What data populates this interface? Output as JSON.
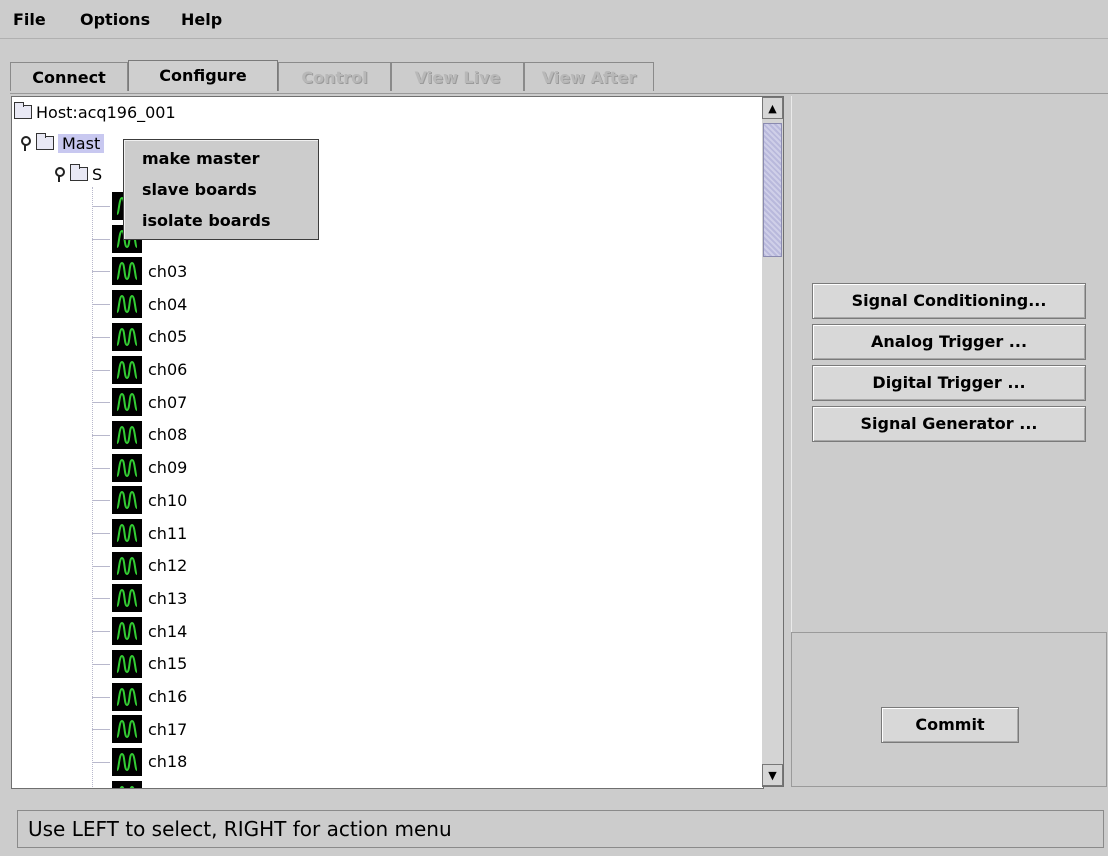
{
  "menu": {
    "file": "File",
    "options": "Options",
    "help": "Help"
  },
  "tabs": [
    {
      "label": "Connect",
      "state": "enabled"
    },
    {
      "label": "Configure",
      "state": "active"
    },
    {
      "label": "Control",
      "state": "disabled"
    },
    {
      "label": "View Live",
      "state": "disabled"
    },
    {
      "label": "View After",
      "state": "disabled"
    }
  ],
  "tree": {
    "host": "Host:acq196_001",
    "master_partial": "Mast",
    "slave_partial": "S",
    "channels": [
      "ch03",
      "ch04",
      "ch05",
      "ch06",
      "ch07",
      "ch08",
      "ch09",
      "ch10",
      "ch11",
      "ch12",
      "ch13",
      "ch14",
      "ch15",
      "ch16",
      "ch17",
      "ch18"
    ]
  },
  "context_menu": {
    "items": [
      "make master",
      "slave boards",
      "isolate boards"
    ]
  },
  "right_panel": {
    "buttons": [
      "Signal Conditioning...",
      "Analog Trigger ...",
      "Digital Trigger ...",
      "Signal Generator ..."
    ],
    "commit": "Commit"
  },
  "status": "Use LEFT to select, RIGHT for action menu",
  "colors": {
    "background": "#cccccc",
    "selection": "#c8c8f0",
    "waveform": "#33cc33",
    "scroll_thumb": "#b9b9dc"
  },
  "icons": {
    "channel": "waveform-icon",
    "folder": "folder-icon",
    "expand": "tree-handle-icon"
  }
}
